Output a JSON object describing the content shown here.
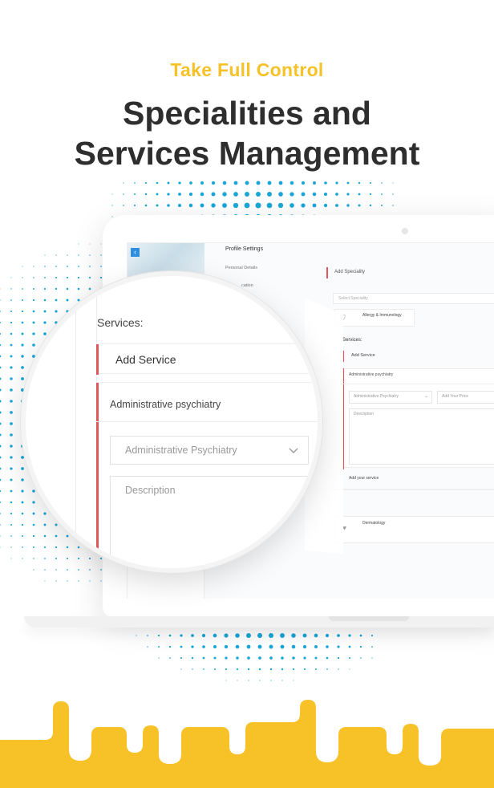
{
  "hero": {
    "eyebrow": "Take Full Control",
    "title_line1": "Specialities and",
    "title_line2": "Services Management"
  },
  "colors": {
    "accent_yellow": "#f6c227",
    "dots_blue": "#1aa7d8",
    "red_marker": "#e0565b",
    "title_dark": "#2e2e2e"
  },
  "screen": {
    "back_icon": "chevron-left-icon",
    "profile_settings": "Profile Settings",
    "nav_personal_details": "Personal Details",
    "nav_education_partial": "cation",
    "add_speciality": "Add Speciality",
    "select_speciality_placeholder": "Select Speciality",
    "speciality_1": "Allergy & Immunology",
    "speciality_1_icon": "tooth-icon",
    "services_label": "Services:",
    "add_service": "Add Service",
    "service_name": "Administrative psychiatry",
    "service_select_value": "Administrative Psychiatry",
    "price_placeholder": "Add Your Price",
    "description_placeholder": "Description",
    "add_your_service": "Add your service",
    "speciality_2": "Dermatology",
    "speciality_2_icon": "dermatology-icon"
  },
  "lens": {
    "services_label": "Services:",
    "add_service": "Add Service",
    "service_name": "Administrative psychiatry",
    "service_select_value": "Administrative Psychiatry",
    "description_placeholder": "Description"
  }
}
